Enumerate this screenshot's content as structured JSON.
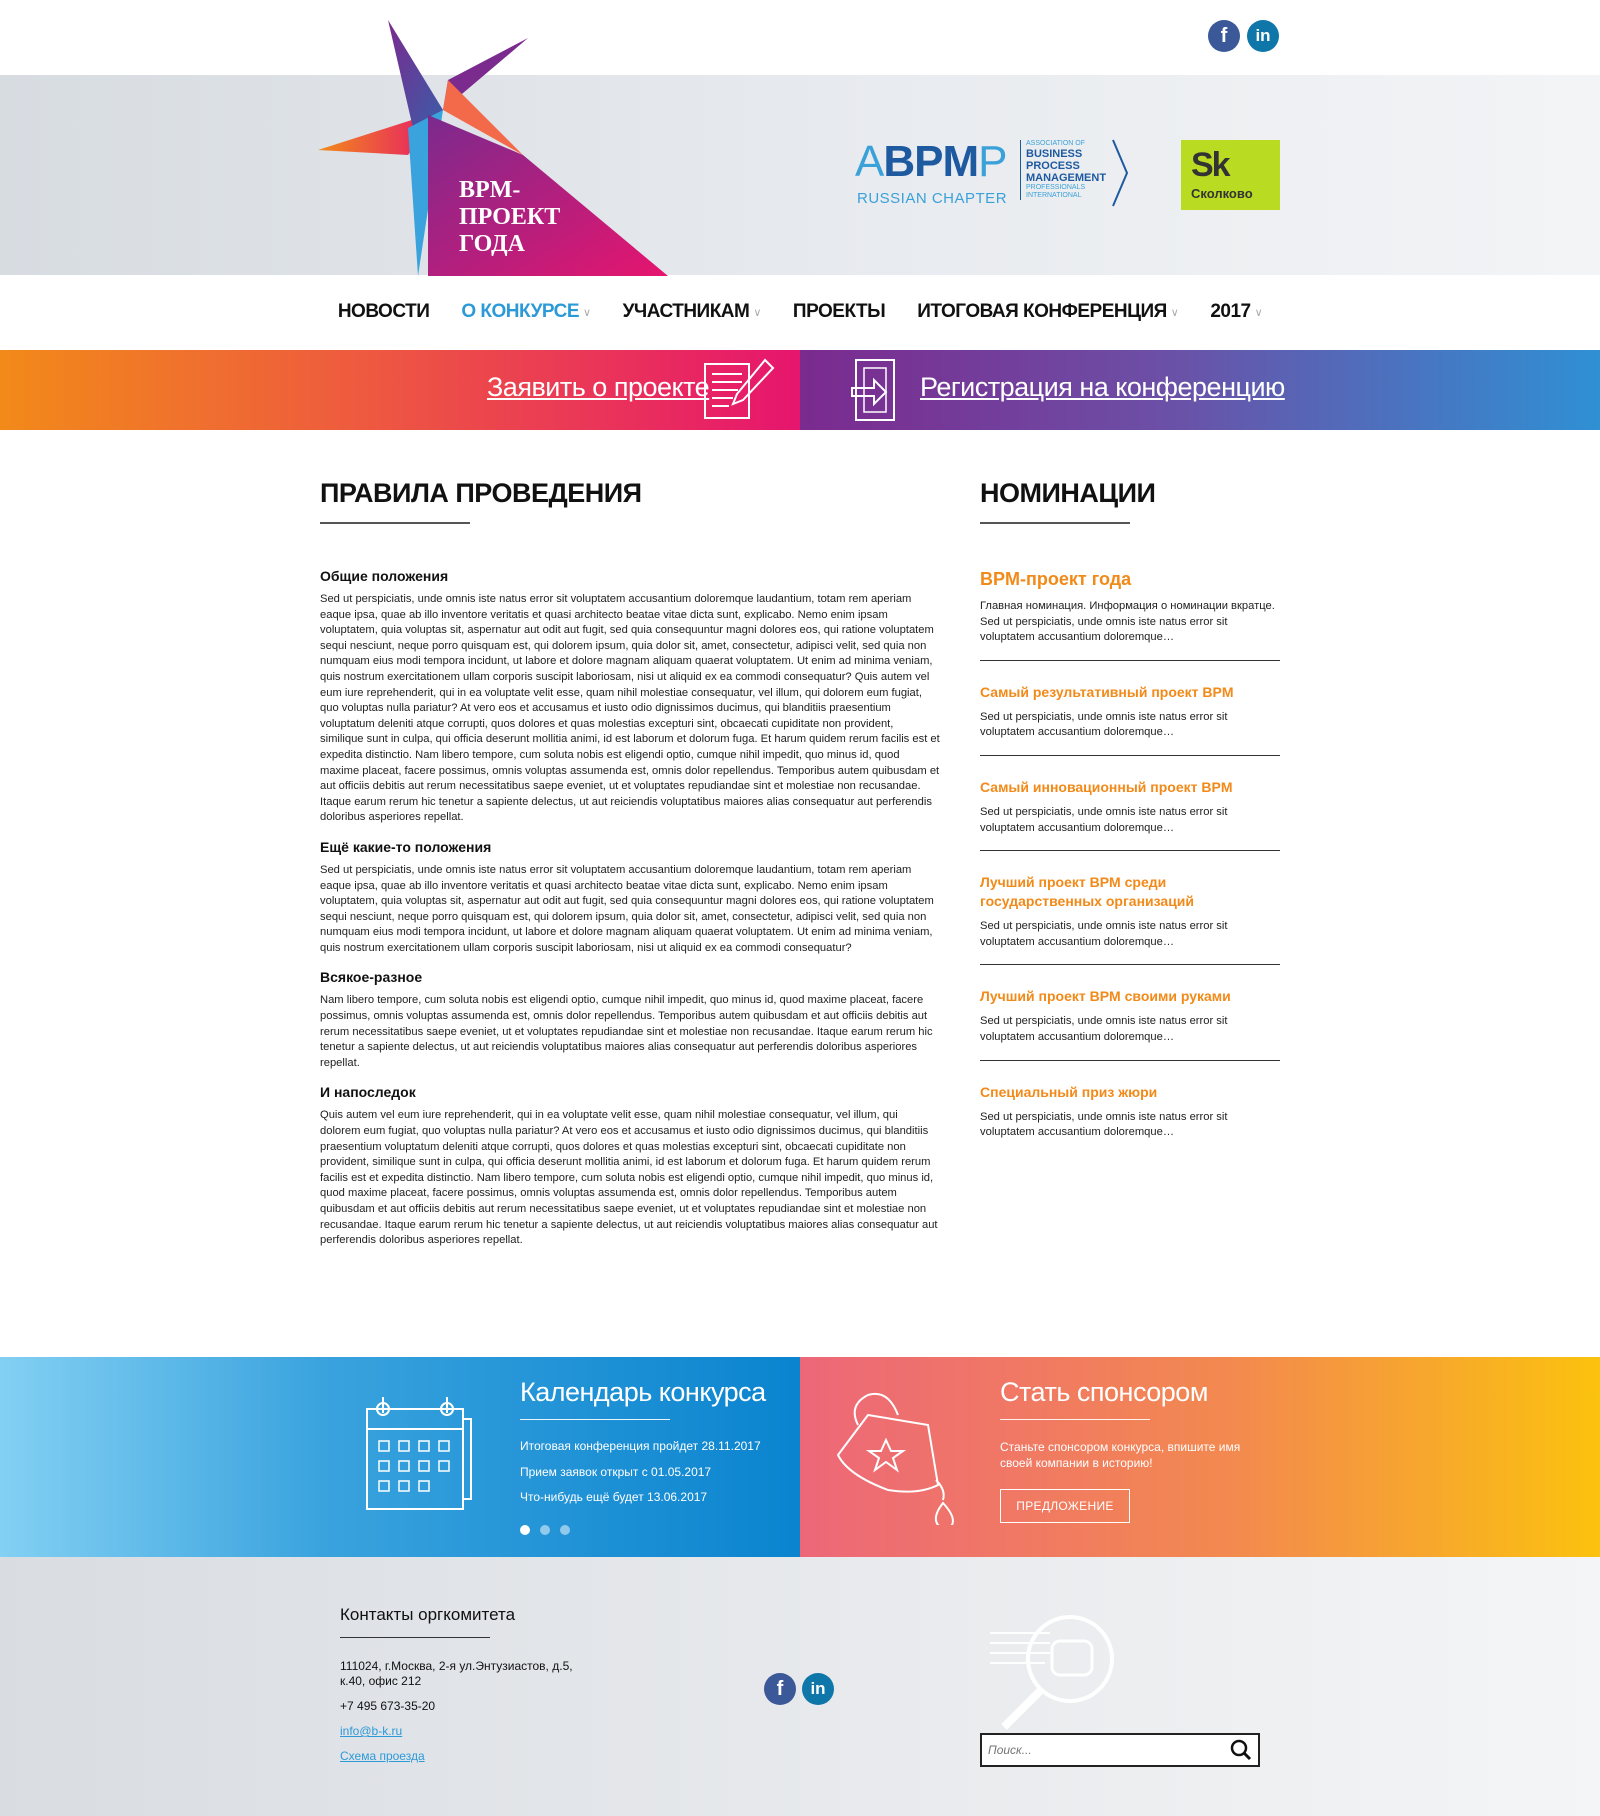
{
  "header": {
    "logo_lines": [
      "BPM-",
      "ПРОЕКТ",
      "ГОДА"
    ],
    "abpmp": {
      "letters_a": "A",
      "letters_bpm": "BPM",
      "letters_p": "P",
      "chapter": "RUSSIAN CHAPTER",
      "assoc": "ASSOCIATION OF",
      "business": "BUSINESS",
      "process": "PROCESS",
      "management": "MANAGEMENT",
      "professionals": "PROFESSIONALS",
      "international": "INTERNATIONAL"
    },
    "skolkovo": {
      "mark": "Sk",
      "name": "Сколково"
    },
    "social": {
      "facebook": "f",
      "linkedin": "in"
    }
  },
  "nav": {
    "items": [
      {
        "label": "НОВОСТИ",
        "dropdown": false
      },
      {
        "label": "О КОНКУРСЕ",
        "dropdown": true
      },
      {
        "label": "УЧАСТНИКАМ",
        "dropdown": true
      },
      {
        "label": "ПРОЕКТЫ",
        "dropdown": false
      },
      {
        "label": "ИТОГОВАЯ КОНФЕРЕНЦИЯ",
        "dropdown": true
      },
      {
        "label": "2017",
        "dropdown": true
      }
    ],
    "active_index": 1,
    "active_color": "#2d9ad8"
  },
  "cta": {
    "apply": "Заявить о проекте",
    "register": "Регистрация на конференцию"
  },
  "rules": {
    "title": "ПРАВИЛА ПРОВЕДЕНИЯ",
    "sections": [
      {
        "heading": "Общие положения",
        "text": "Sed ut perspiciatis, unde omnis iste natus error sit voluptatem accusantium doloremque laudantium, totam rem aperiam eaque ipsa, quae ab illo inventore veritatis et quasi architecto beatae vitae dicta sunt, explicabo. Nemo enim ipsam voluptatem, quia voluptas sit, aspernatur aut odit aut fugit, sed quia consequuntur magni dolores eos, qui ratione voluptatem sequi nesciunt, neque porro quisquam est, qui dolorem ipsum, quia dolor sit, amet, consectetur, adipisci velit, sed quia non numquam eius modi tempora incidunt, ut labore et dolore magnam aliquam quaerat voluptatem. Ut enim ad minima veniam, quis nostrum exercitationem ullam corporis suscipit laboriosam, nisi ut aliquid ex ea commodi consequatur? Quis autem vel eum iure reprehenderit, qui in ea voluptate velit esse, quam nihil molestiae consequatur, vel illum, qui dolorem eum fugiat, quo voluptas nulla pariatur? At vero eos et accusamus et iusto odio dignissimos ducimus, qui blanditiis praesentium voluptatum deleniti atque corrupti, quos dolores et quas molestias excepturi sint, obcaecati cupiditate non provident, similique sunt in culpa, qui officia deserunt mollitia animi, id est laborum et dolorum fuga. Et harum quidem rerum facilis est et expedita distinctio. Nam libero tempore, cum soluta nobis est eligendi optio, cumque nihil impedit, quo minus id, quod maxime placeat, facere possimus, omnis voluptas assumenda est, omnis dolor repellendus. Temporibus autem quibusdam et aut officiis debitis aut rerum necessitatibus saepe eveniet, ut et voluptates repudiandae sint et molestiae non recusandae. Itaque earum rerum hic tenetur a sapiente delectus, ut aut reiciendis voluptatibus maiores alias consequatur aut perferendis doloribus asperiores repellat."
      },
      {
        "heading": "Ещё какие-то положения",
        "text": "Sed ut perspiciatis, unde omnis iste natus error sit voluptatem accusantium doloremque laudantium, totam rem aperiam eaque ipsa, quae ab illo inventore veritatis et quasi architecto beatae vitae dicta sunt, explicabo. Nemo enim ipsam voluptatem, quia voluptas sit, aspernatur aut odit aut fugit, sed quia consequuntur magni dolores eos, qui ratione voluptatem sequi nesciunt, neque porro quisquam est, qui dolorem ipsum, quia dolor sit, amet, consectetur, adipisci velit, sed quia non numquam eius modi tempora incidunt, ut labore et dolore magnam aliquam quaerat voluptatem. Ut enim ad minima veniam, quis nostrum exercitationem ullam corporis suscipit laboriosam, nisi ut aliquid ex ea commodi consequatur?"
      },
      {
        "heading": "Всякое-разное",
        "text": "Nam libero tempore, cum soluta nobis est eligendi optio, cumque nihil impedit, quo minus id, quod maxime placeat, facere possimus, omnis voluptas assumenda est, omnis dolor repellendus. Temporibus autem quibusdam et aut officiis debitis aut rerum necessitatibus saepe eveniet, ut et voluptates repudiandae sint et molestiae non recusandae. Itaque earum rerum hic tenetur a sapiente delectus, ut aut reiciendis voluptatibus maiores alias consequatur aut perferendis doloribus asperiores repellat."
      },
      {
        "heading": "И напоследок",
        "text": "Quis autem vel eum iure reprehenderit, qui in ea voluptate velit esse, quam nihil molestiae consequatur, vel illum, qui dolorem eum fugiat, quo voluptas nulla pariatur? At vero eos et accusamus et iusto odio dignissimos ducimus, qui blanditiis praesentium voluptatum deleniti atque corrupti, quos dolores et quas molestias excepturi sint, obcaecati cupiditate non provident, similique sunt in culpa, qui officia deserunt mollitia animi, id est laborum et dolorum fuga. Et harum quidem rerum facilis est et expedita distinctio. Nam libero tempore, cum soluta nobis est eligendi optio, cumque nihil impedit, quo minus id, quod maxime placeat, facere possimus, omnis voluptas assumenda est, omnis dolor repellendus. Temporibus autem quibusdam et aut officiis debitis aut rerum necessitatibus saepe eveniet, ut et voluptates repudiandae sint et molestiae non recusandae. Itaque earum rerum hic tenetur a sapiente delectus, ut aut reiciendis voluptatibus maiores alias consequatur aut perferendis doloribus asperiores repellat."
      }
    ]
  },
  "nominations": {
    "title": "НОМИНАЦИИ",
    "accent_color": "#f28a19",
    "items": [
      {
        "title": "BPM-проект года",
        "desc": "Главная номинация. Информация о номинации вкратце. Sed ut perspiciatis, unde omnis iste natus error sit voluptatem accusantium doloremque…"
      },
      {
        "title": "Самый результативный проект BPM",
        "desc": "Sed ut perspiciatis, unde omnis iste natus error sit voluptatem accusantium doloremque…"
      },
      {
        "title": "Самый инновационный проект BPM",
        "desc": "Sed ut perspiciatis, unde omnis iste natus error sit voluptatem accusantium doloremque…"
      },
      {
        "title": "Лучший проект BPM среди государственных организаций",
        "desc": "Sed ut perspiciatis, unde omnis iste natus error sit voluptatem accusantium doloremque…"
      },
      {
        "title": "Лучший проект BPM своими руками",
        "desc": "Sed ut perspiciatis, unde omnis iste natus error sit voluptatem accusantium doloremque…"
      },
      {
        "title": "Специальный приз жюри",
        "desc": "Sed ut perspiciatis, unde omnis iste natus error sit voluptatem accusantium doloremque…"
      }
    ]
  },
  "calendar": {
    "title": "Календарь конкурса",
    "events": [
      "Итоговая конференция пройдет 28.11.2017",
      "Прием заявок открыт с 01.05.2017",
      "Что-нибудь ещё будет 13.06.2017"
    ],
    "active_dot": 0,
    "dot_count": 3
  },
  "sponsor": {
    "title": "Стать спонсором",
    "text": "Станьте спонсором конкурса, впишите имя своей компании в историю!",
    "button": "ПРЕДЛОЖЕНИЕ"
  },
  "footer": {
    "contacts_title": "Контакты оргкомитета",
    "address": "111024, г.Москва, 2-я ул.Энтузиастов, д.5, к.40, офис 212",
    "phone": "+7 495 673-35-20",
    "email": "info@b-k.ru",
    "map_link": "Схема проезда",
    "search_placeholder": "Поиск...",
    "social": {
      "facebook": "f",
      "linkedin": "in"
    }
  }
}
